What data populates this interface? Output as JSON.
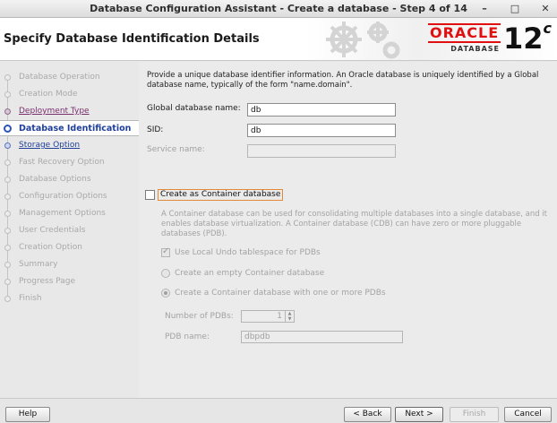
{
  "window": {
    "title": "Database Configuration Assistant - Create a database - Step 4 of 14",
    "minimize": "–",
    "maximize": "□",
    "close": "✕"
  },
  "header": {
    "title": "Specify Database Identification Details",
    "brand": "ORACLE",
    "brand_sub": "DATABASE",
    "version": "12",
    "version_suffix": "c"
  },
  "nav": {
    "items": [
      {
        "label": "Database Operation",
        "state": "disabled"
      },
      {
        "label": "Creation Mode",
        "state": "disabled"
      },
      {
        "label": "Deployment Type",
        "state": "done"
      },
      {
        "label": "Database Identification",
        "state": "current"
      },
      {
        "label": "Storage Option",
        "state": "link"
      },
      {
        "label": "Fast Recovery Option",
        "state": "disabled"
      },
      {
        "label": "Database Options",
        "state": "disabled"
      },
      {
        "label": "Configuration Options",
        "state": "disabled"
      },
      {
        "label": "Management Options",
        "state": "disabled"
      },
      {
        "label": "User Credentials",
        "state": "disabled"
      },
      {
        "label": "Creation Option",
        "state": "disabled"
      },
      {
        "label": "Summary",
        "state": "disabled"
      },
      {
        "label": "Progress Page",
        "state": "disabled"
      },
      {
        "label": "Finish",
        "state": "disabled"
      }
    ]
  },
  "main": {
    "intro": "Provide a unique database identifier information. An Oracle database is uniquely identified by a Global database name, typically of the form \"name.domain\".",
    "global_db_name_label": "Global database name:",
    "global_db_name_value": "db",
    "sid_label": "SID:",
    "sid_value": "db",
    "service_name_label": "Service name:",
    "service_name_value": "",
    "cdb_checkbox_label": "Create as Container database",
    "cdb_checked": false,
    "cdb_description": "A Container database can be used for consolidating multiple databases into a single database, and it enables database virtualization. A Container database (CDB) can have zero or more pluggable databases (PDB).",
    "local_undo_label": "Use Local Undo tablespace for PDBs",
    "empty_cdb_label": "Create an empty Container database",
    "cdb_with_pdbs_label": "Create a Container database with one or more PDBs",
    "num_pdbs_label": "Number of PDBs:",
    "num_pdbs_value": "1",
    "pdb_name_label": "PDB name:",
    "pdb_name_value": "dbpdb"
  },
  "buttons": {
    "help": "Help",
    "back": "< Back",
    "next": "Next >",
    "finish": "Finish",
    "cancel": "Cancel"
  }
}
